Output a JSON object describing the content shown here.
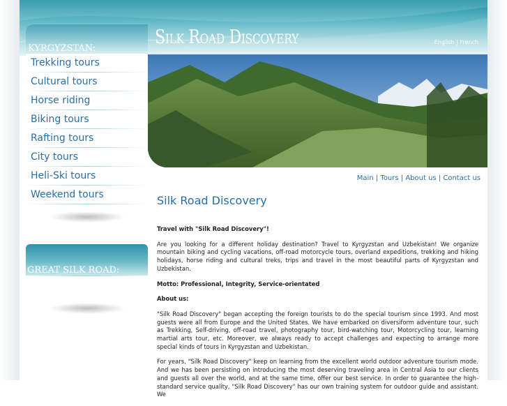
{
  "header": {
    "logo": "Silk Road Discovery",
    "languages": [
      "English",
      "French"
    ]
  },
  "sidebar": {
    "section_title": "KYRGYZSTAN:",
    "items": [
      {
        "label": "Trekking tours"
      },
      {
        "label": "Cultural tours"
      },
      {
        "label": "Horse riding"
      },
      {
        "label": "Biking tours"
      },
      {
        "label": "Rafting tours"
      },
      {
        "label": "City tours"
      },
      {
        "label": "Heli-Ski tours"
      },
      {
        "label": "Weekend tours"
      }
    ],
    "second_section_title": "GREAT SILK ROAD:"
  },
  "topnav": {
    "items": [
      "Main",
      "Tours",
      "About us",
      "Contact us"
    ]
  },
  "content": {
    "title": "Silk Road Discovery",
    "intro_heading": "Travel with \"Silk Road Discovery\"!",
    "intro": "Are you looking for a different holiday destination? Travel to Kyrgyzstan and Uzbekistan! We organize mountain biking and cycling vacations, off-road motorcycle tours, overland expeditions, trekking and hiking holidays, horse riding and cultural treks, trips and travel in the most beautiful parts of Kyrgyzstan and Uzbekistan.",
    "motto": "Motto: Professional, Integrity, Service-orientated",
    "about_heading": "About us:",
    "about_p1": "\"Silk Road Discovery\" began accepting the foreign tourists to do the special tourism since 1993. And most guests were all from Europe and the United States. We have embarked on diversiform adventure tour, such as Trekking, Self-driving, off-road travel, photography tour, bird-watching tour, Motorcycling tour, learning martial arts tour, etc. Moreover, we always ready to accept challenges and expecting to arrange more special kinds of tours in Kyrgyzstan and Uzbekistan.",
    "about_p2": "For years, \"Silk Road Discovery\" keep on learning from the excellent world outdoor adventure tourism mode. And we has been persisting on introducing the most deserving traveling area in Central Asia to our clients and guests all over the world, and at the same time, offer our best service. In order to guarantee the high-standard service quality, \"Silk Road Discovery\" has our own training system for outdoor guide and assistant. We"
  },
  "colors": {
    "link": "#2a6ea6",
    "header_teal": "#1f8fa4",
    "text": "#222222"
  }
}
